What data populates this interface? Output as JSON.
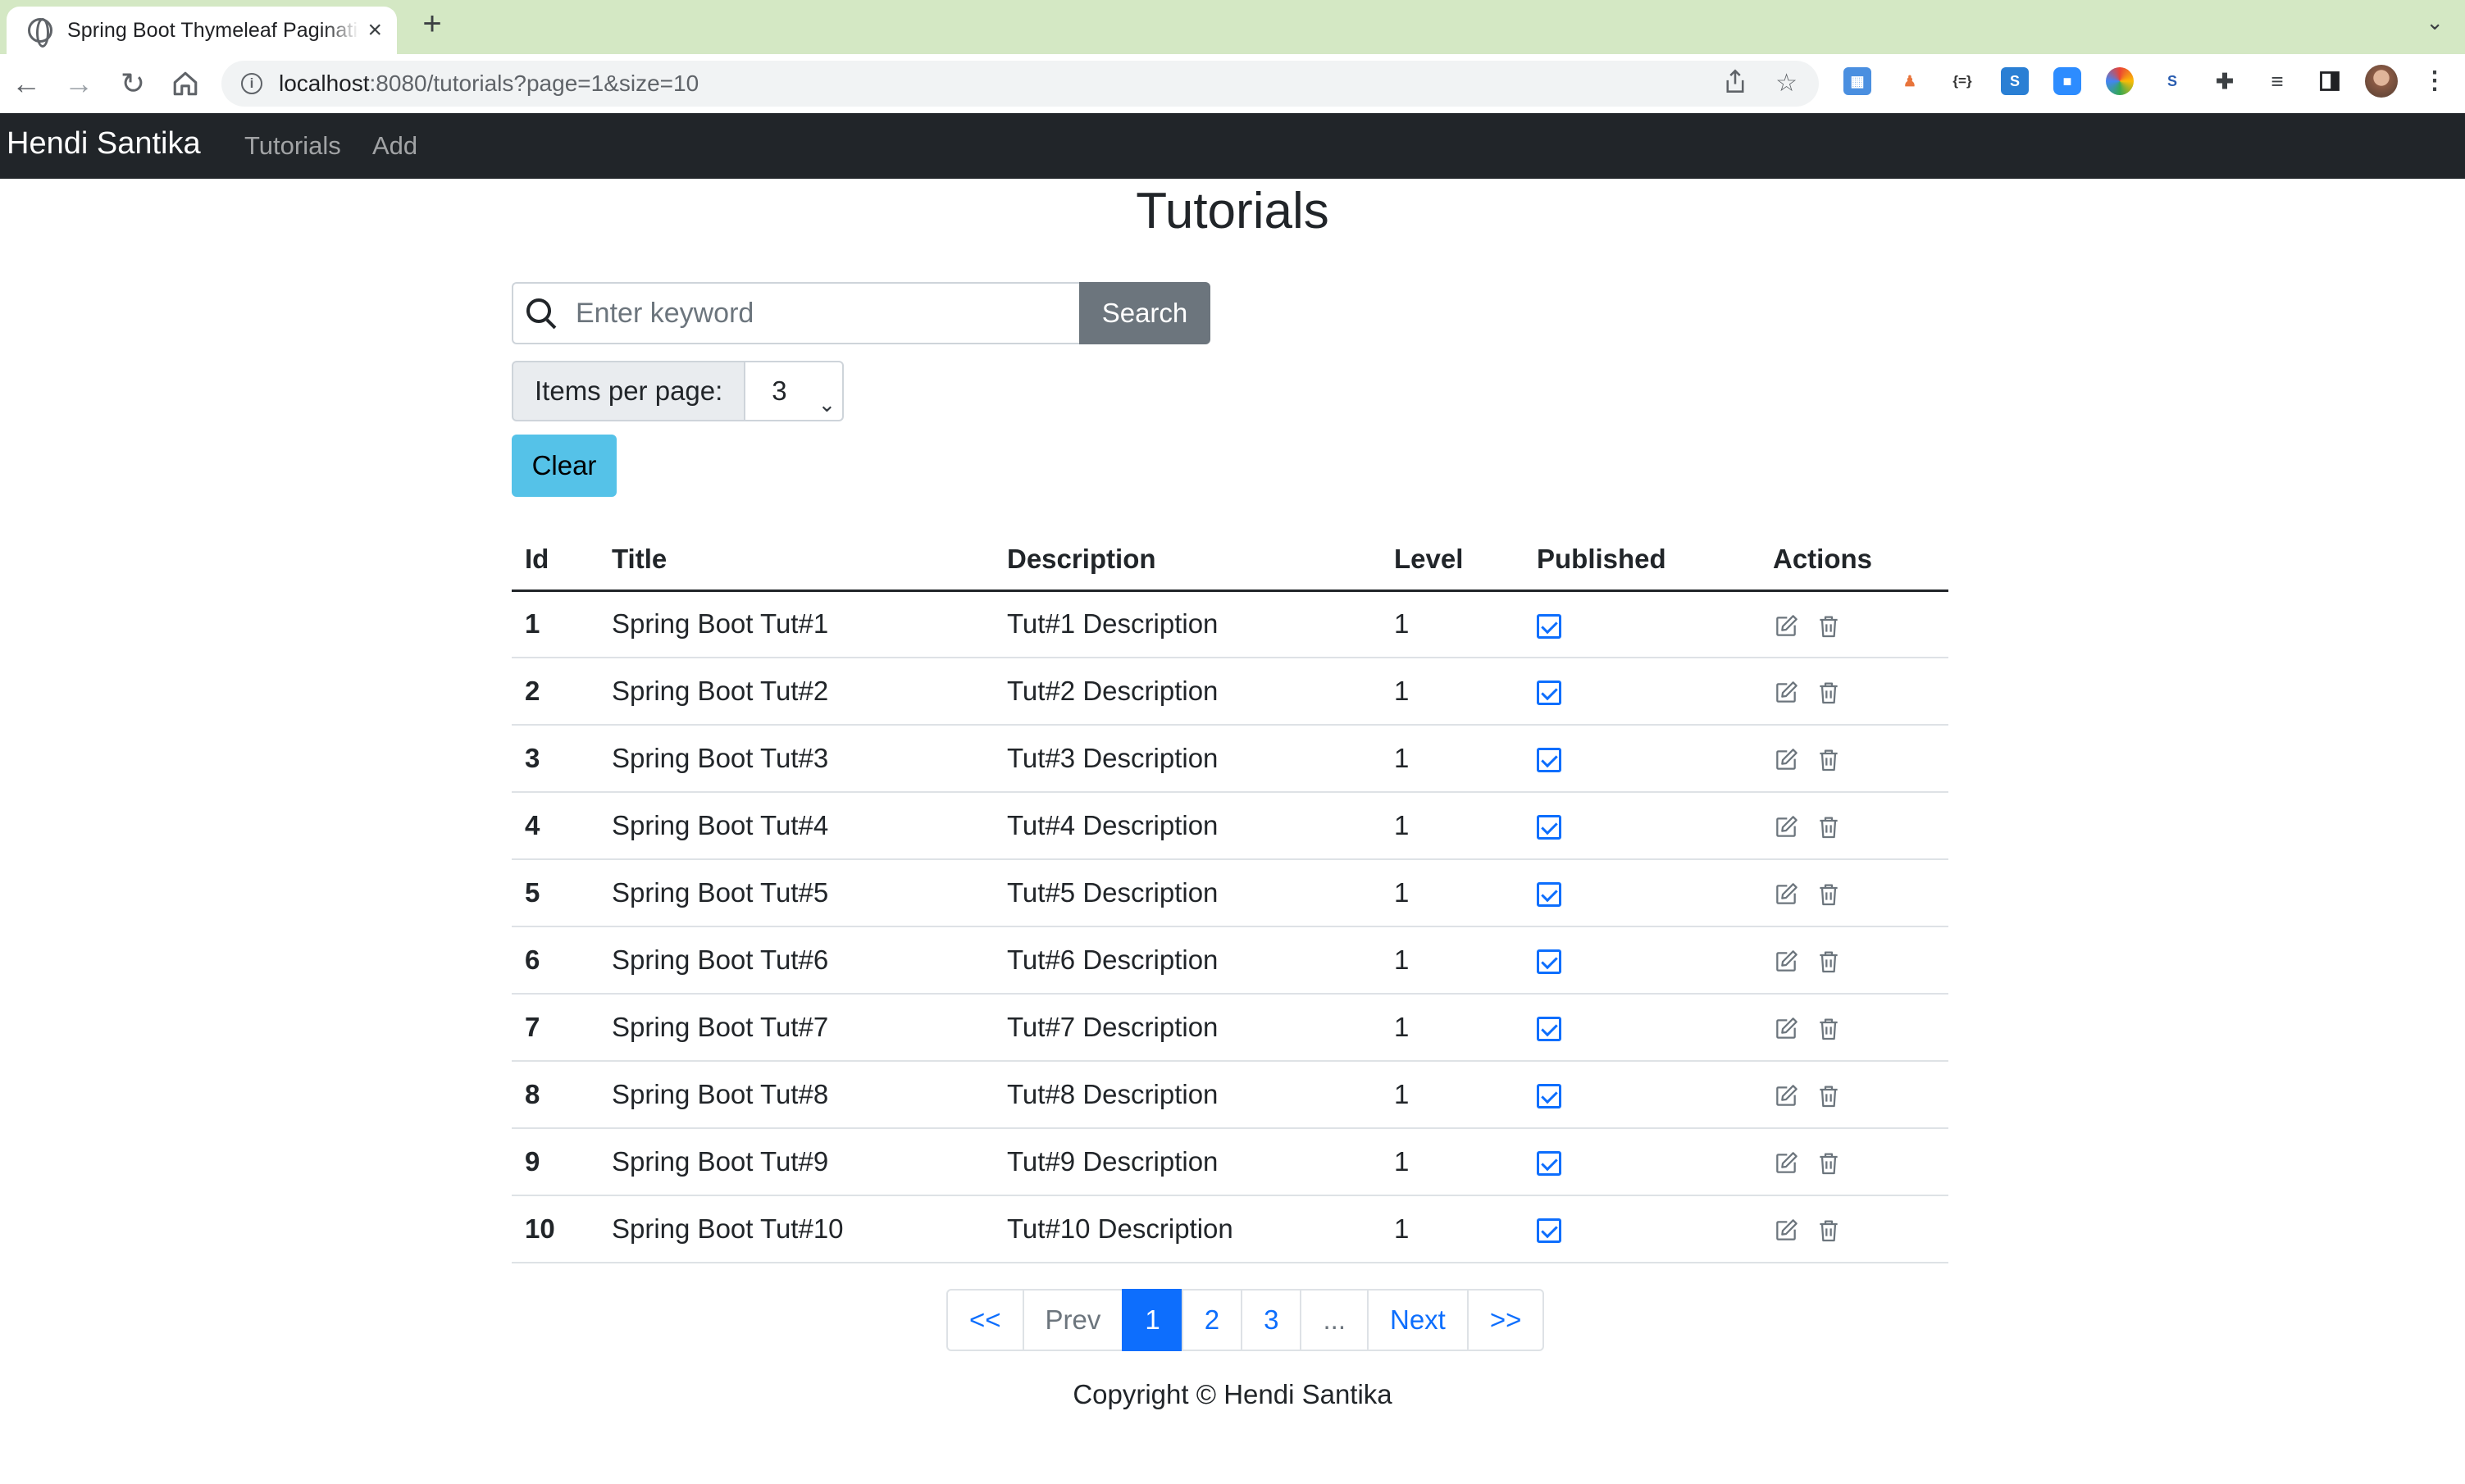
{
  "browser": {
    "tab_title": "Spring Boot Thymeleaf Pagination",
    "tab_close": "×",
    "new_tab": "+",
    "url_host": "localhost",
    "url_path": ":8080/tutorials?page=1&size=10"
  },
  "navbar": {
    "brand": "Hendi Santika",
    "links": [
      "Tutorials",
      "Add"
    ]
  },
  "page": {
    "title": "Tutorials"
  },
  "search": {
    "placeholder": "Enter keyword",
    "value": "",
    "button_label": "Search"
  },
  "per_page": {
    "label": "Items per page:",
    "selected": "3"
  },
  "clear_label": "Clear",
  "table": {
    "columns": [
      "Id",
      "Title",
      "Description",
      "Level",
      "Published",
      "Actions"
    ],
    "rows": [
      {
        "id": "1",
        "title": "Spring Boot Tut#1",
        "description": "Tut#1 Description",
        "level": "1",
        "published": true
      },
      {
        "id": "2",
        "title": "Spring Boot Tut#2",
        "description": "Tut#2 Description",
        "level": "1",
        "published": true
      },
      {
        "id": "3",
        "title": "Spring Boot Tut#3",
        "description": "Tut#3 Description",
        "level": "1",
        "published": true
      },
      {
        "id": "4",
        "title": "Spring Boot Tut#4",
        "description": "Tut#4 Description",
        "level": "1",
        "published": true
      },
      {
        "id": "5",
        "title": "Spring Boot Tut#5",
        "description": "Tut#5 Description",
        "level": "1",
        "published": true
      },
      {
        "id": "6",
        "title": "Spring Boot Tut#6",
        "description": "Tut#6 Description",
        "level": "1",
        "published": true
      },
      {
        "id": "7",
        "title": "Spring Boot Tut#7",
        "description": "Tut#7 Description",
        "level": "1",
        "published": true
      },
      {
        "id": "8",
        "title": "Spring Boot Tut#8",
        "description": "Tut#8 Description",
        "level": "1",
        "published": true
      },
      {
        "id": "9",
        "title": "Spring Boot Tut#9",
        "description": "Tut#9 Description",
        "level": "1",
        "published": true
      },
      {
        "id": "10",
        "title": "Spring Boot Tut#10",
        "description": "Tut#10 Description",
        "level": "1",
        "published": true
      }
    ]
  },
  "pagination": {
    "items": [
      {
        "label": "<<",
        "state": "normal"
      },
      {
        "label": "Prev",
        "state": "disabled"
      },
      {
        "label": "1",
        "state": "active"
      },
      {
        "label": "2",
        "state": "normal"
      },
      {
        "label": "3",
        "state": "normal"
      },
      {
        "label": "...",
        "state": "disabled"
      },
      {
        "label": "Next",
        "state": "normal"
      },
      {
        "label": ">>",
        "state": "normal"
      }
    ]
  },
  "footer": {
    "copyright": "Copyright © Hendi Santika"
  },
  "colors": {
    "navbar_bg": "#212529",
    "primary": "#0d6efd",
    "secondary": "#6c757d",
    "info": "#55c2e8",
    "tabstrip": "#d4e8c4"
  }
}
